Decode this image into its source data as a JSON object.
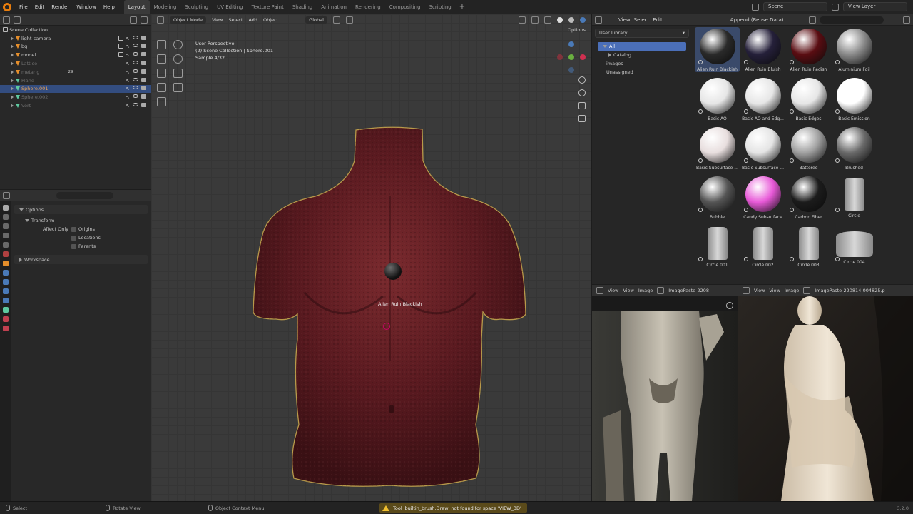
{
  "menu": [
    "File",
    "Edit",
    "Render",
    "Window",
    "Help"
  ],
  "workspaces": [
    "Layout",
    "Modeling",
    "Sculpting",
    "UV Editing",
    "Texture Paint",
    "Shading",
    "Animation",
    "Rendering",
    "Compositing",
    "Scripting"
  ],
  "active_workspace": "Layout",
  "scene_name": "Scene",
  "view_layer": "View Layer",
  "outliner": {
    "root": "Scene Collection",
    "items": [
      {
        "name": "light-camera",
        "style": "normal"
      },
      {
        "name": "bg",
        "style": "normal"
      },
      {
        "name": "model",
        "style": "normal"
      },
      {
        "name": "Lattice",
        "style": "dim"
      },
      {
        "name": "metarig",
        "style": "dim"
      },
      {
        "name": "Plane",
        "style": "dim"
      },
      {
        "name": "Sphere.001",
        "style": "orange"
      },
      {
        "name": "Sphere.002",
        "style": "dim"
      },
      {
        "name": "Vert",
        "style": "dim"
      }
    ],
    "selected_index": 6,
    "metarig_count": "29"
  },
  "properties": {
    "section": "Options",
    "subsection": "Transform",
    "affect_only_label": "Affect Only",
    "checkboxes": [
      "Origins",
      "Locations",
      "Parents"
    ],
    "workspace_section": "Workspace"
  },
  "viewport": {
    "header": {
      "mode": "Object Mode",
      "menus": [
        "View",
        "Select",
        "Add",
        "Object"
      ],
      "orientation": "Global",
      "options": "Options"
    },
    "info": {
      "line1": "User Perspective",
      "line2": "(2) Scene Collection | Sphere.001",
      "line3": "Sample 4/32"
    },
    "drag_label": "Alien Ruin Blackish"
  },
  "asset_browser": {
    "menus": [
      "View",
      "Select",
      "Edit"
    ],
    "import_mode": "Append (Reuse Data)",
    "library": "User Library",
    "categories": [
      {
        "name": "All",
        "selected": true
      },
      {
        "name": "Catalog",
        "selected": false
      },
      {
        "name": "images",
        "selected": false
      },
      {
        "name": "Unassigned",
        "selected": false
      }
    ],
    "assets": [
      {
        "name": "Alien Ruin Blackish",
        "kind": "sphere",
        "color": "#2a2a2a",
        "selected": true
      },
      {
        "name": "Alien Ruin Bluish",
        "kind": "sphere",
        "color": "#25203a",
        "selected": false
      },
      {
        "name": "Alien Ruin Redish",
        "kind": "sphere",
        "color": "#5a0d12",
        "selected": false
      },
      {
        "name": "Aluminium Foil",
        "kind": "sphere",
        "color": "#8a8a8a",
        "selected": false
      },
      {
        "name": "Basic AO",
        "kind": "sphere",
        "color": "#e6e6e6",
        "selected": false
      },
      {
        "name": "Basic AO and Edg...",
        "kind": "sphere",
        "color": "#e6e6e6",
        "selected": false
      },
      {
        "name": "Basic Edges",
        "kind": "sphere",
        "color": "#e6e6e6",
        "selected": false
      },
      {
        "name": "Basic Emission",
        "kind": "sphere",
        "color": "#ffffff",
        "selected": false
      },
      {
        "name": "Basic Subsurface ...",
        "kind": "sphere",
        "color": "#e8dede",
        "selected": false
      },
      {
        "name": "Basic Subsurface ...",
        "kind": "sphere",
        "color": "#e4e4e4",
        "selected": false
      },
      {
        "name": "Battered",
        "kind": "sphere",
        "color": "#a0a0a0",
        "selected": false
      },
      {
        "name": "Brushed",
        "kind": "sphere",
        "color": "#6a6a6a",
        "selected": false
      },
      {
        "name": "Bubble",
        "kind": "sphere",
        "color": "#555555",
        "selected": false
      },
      {
        "name": "Candy Subsurface",
        "kind": "sphere",
        "color": "#e85ad8",
        "selected": false
      },
      {
        "name": "Carbon Fiber",
        "kind": "sphere",
        "color": "#1c1c1c",
        "selected": false
      },
      {
        "name": "Circle",
        "kind": "cyl",
        "color": "#b0b0b0",
        "selected": false
      },
      {
        "name": "Circle.001",
        "kind": "cyl",
        "color": "#b0b0b0",
        "selected": false
      },
      {
        "name": "Circle.002",
        "kind": "cyl",
        "color": "#d0d0d0",
        "selected": false
      },
      {
        "name": "Circle.003",
        "kind": "cyl",
        "color": "#b0b0b0",
        "selected": false
      },
      {
        "name": "Circle.004",
        "kind": "cylwide",
        "color": "#b0b0b0",
        "selected": false
      }
    ]
  },
  "image_editors": [
    {
      "menus": [
        "View",
        "View",
        "Image"
      ],
      "image": "ImagePaste-2208"
    },
    {
      "menus": [
        "View",
        "View",
        "Image"
      ],
      "image": "ImagePaste-220814-004825.p"
    }
  ],
  "status": {
    "select": "Select",
    "rotate": "Rotate View",
    "context_menu": "Object Context Menu",
    "warning": "Tool 'builtin_brush.Draw' not found for space 'VIEW_3D'",
    "version": "3.2.0"
  }
}
